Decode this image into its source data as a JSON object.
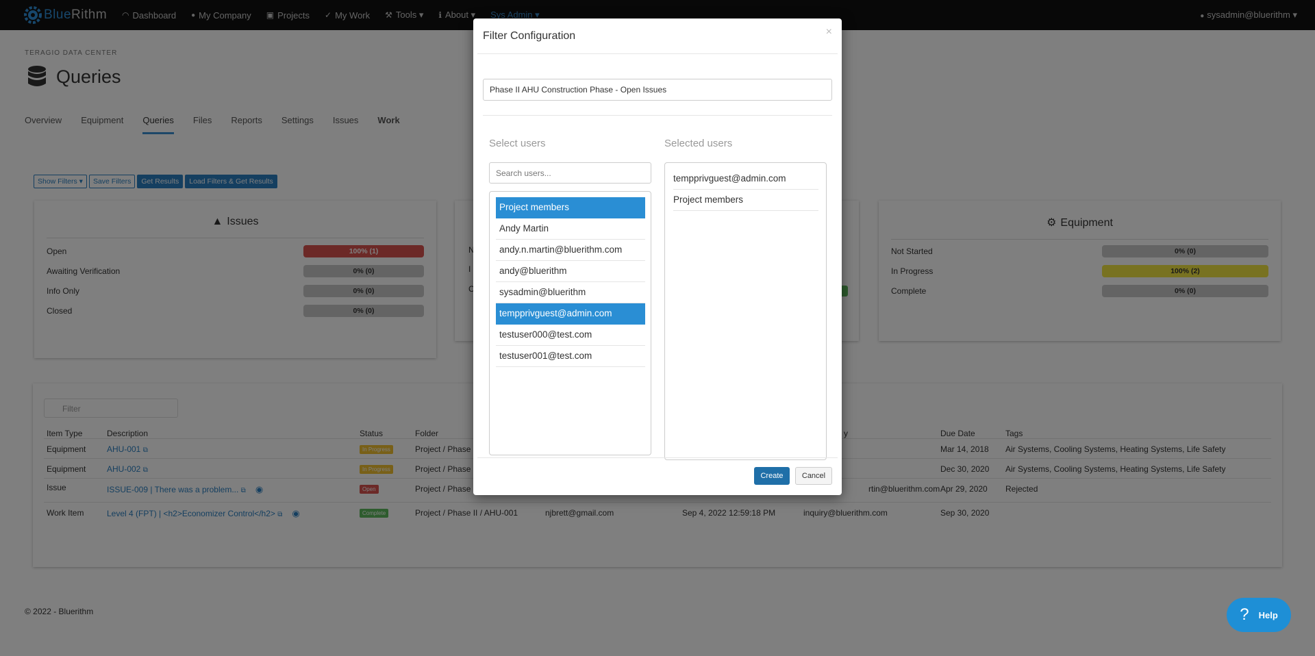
{
  "nav": {
    "brand_part1": "Blue",
    "brand_part2": "Rithm",
    "items": [
      {
        "label": "Dashboard",
        "icon": "speedometer-icon",
        "glyph": "◠"
      },
      {
        "label": "My Company",
        "icon": "users-icon",
        "glyph": "👥"
      },
      {
        "label": "Projects",
        "icon": "briefcase-icon",
        "glyph": "▣"
      },
      {
        "label": "My Work",
        "icon": "check-icon",
        "glyph": "✓"
      },
      {
        "label": "Tools ▾",
        "icon": "wrench-icon",
        "glyph": "⚒"
      },
      {
        "label": "About ▾",
        "icon": "info-icon",
        "glyph": "ℹ"
      },
      {
        "label": "Sys Admin ▾",
        "icon": "",
        "glyph": ""
      }
    ],
    "user": "sysadmin@bluerithm ▾"
  },
  "page": {
    "eyebrow": "TERAGIO DATA CENTER",
    "title": "Queries",
    "tabs": [
      "Overview",
      "Equipment",
      "Queries",
      "Files",
      "Reports",
      "Settings",
      "Issues",
      "Work"
    ],
    "buttons": [
      "Show Filters ▾",
      "Save Filters",
      "Get Results",
      "Load Filters & Get Results"
    ]
  },
  "summary": {
    "issues": {
      "title": "Issues",
      "rows": [
        {
          "label": "Open",
          "value": "100% (1)"
        },
        {
          "label": "Awaiting Verification",
          "value": "0% (0)"
        },
        {
          "label": "Info Only",
          "value": "0% (0)"
        },
        {
          "label": "Closed",
          "value": "0% (0)"
        }
      ]
    },
    "equipment": {
      "title": "Equipment",
      "rows": [
        {
          "label": "Not Started",
          "value": "0% (0)"
        },
        {
          "label": "In Progress",
          "value": "100% (2)"
        },
        {
          "label": "Complete",
          "value": "0% (0)"
        }
      ]
    },
    "middle_fragments": {
      "a": "N",
      "b": "I",
      "c": "C"
    }
  },
  "table": {
    "filter_placeholder": "Filter",
    "headers": {
      "item_type": "Item Type",
      "description": "Description",
      "status": "Status",
      "folder": "Folder",
      "assigned_fragment": "y",
      "due_date": "Due Date",
      "tags": "Tags"
    },
    "rows": [
      {
        "type": "Equipment",
        "desc": "AHU-001",
        "status": "In Progress",
        "folder": "Project / Phase",
        "c5": "",
        "c6": "",
        "c7": "",
        "due": "Mar 14, 2018",
        "tags": "Air Systems, Cooling Systems, Heating Systems, Life Safety"
      },
      {
        "type": "Equipment",
        "desc": "AHU-002",
        "status": "In Progress",
        "folder": "Project / Phase",
        "c5": "",
        "c6": "",
        "c7": "",
        "due": "Dec 30, 2020",
        "tags": "Air Systems, Cooling Systems, Heating Systems, Life Safety"
      },
      {
        "type": "Issue",
        "desc": "ISSUE-009 | There was a problem...",
        "status": "Open",
        "folder": "Project / Phase",
        "c5": "",
        "c6": "",
        "c7": "rtin@bluerithm.com",
        "due": "Apr 29, 2020",
        "tags": "Rejected"
      },
      {
        "type": "Work Item",
        "desc": "Level 4 (FPT) | <h2>Economizer Control</h2>",
        "status": "Complete",
        "folder": "Project / Phase II / AHU-001",
        "c5": "njbrett@gmail.com",
        "c6": "Sep 4, 2022 12:59:18 PM",
        "c7": "inquiry@bluerithm.com",
        "due": "Sep 30, 2020",
        "tags": ""
      }
    ]
  },
  "footer": "© 2022 - Bluerithm",
  "help_label": "Help",
  "modal": {
    "title": "Filter Configuration",
    "close": "×",
    "filter_name": "Phase II AHU Construction Phase - Open Issues",
    "select_heading": "Select users",
    "selected_heading": "Selected users",
    "search_placeholder": "Search users...",
    "users": [
      {
        "label": "Project members",
        "selected": true
      },
      {
        "label": "Andy Martin",
        "selected": false
      },
      {
        "label": "andy.n.martin@bluerithm.com",
        "selected": false
      },
      {
        "label": "andy@bluerithm",
        "selected": false
      },
      {
        "label": "sysadmin@bluerithm",
        "selected": false
      },
      {
        "label": "tempprivguest@admin.com",
        "selected": true
      },
      {
        "label": "testuser000@test.com",
        "selected": false
      },
      {
        "label": "testuser001@test.com",
        "selected": false
      }
    ],
    "selected_users": [
      "tempprivguest@admin.com",
      "Project members"
    ],
    "create_label": "Create",
    "cancel_label": "Cancel"
  },
  "colors": {
    "accent": "#2a8ed4",
    "danger": "#d9534f",
    "warning": "#f0e442",
    "success": "#5cb85c"
  }
}
